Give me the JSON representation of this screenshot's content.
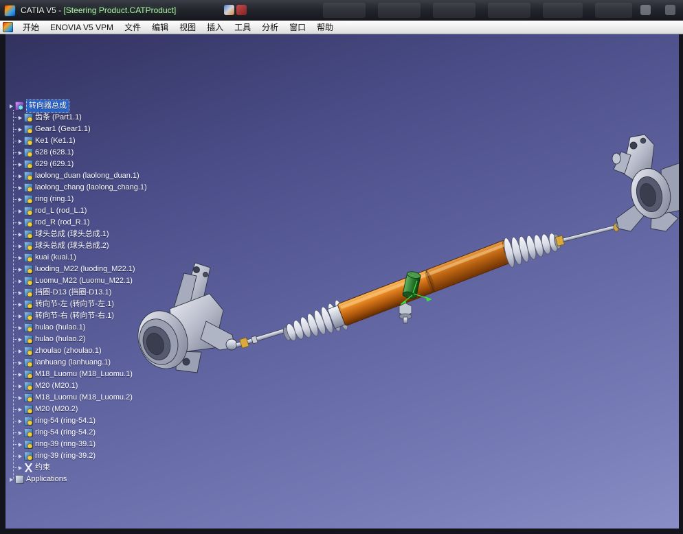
{
  "window": {
    "title_prefix": "CATIA V5 - ",
    "title_document": "[Steering Product.CATProduct]"
  },
  "menubar": {
    "items": [
      {
        "label": "开始"
      },
      {
        "label": "ENOVIA V5 VPM"
      },
      {
        "label": "文件"
      },
      {
        "label": "编辑"
      },
      {
        "label": "视图"
      },
      {
        "label": "插入"
      },
      {
        "label": "工具"
      },
      {
        "label": "分析"
      },
      {
        "label": "窗口"
      },
      {
        "label": "帮助"
      }
    ]
  },
  "tree": {
    "root": {
      "label": "转向器总成",
      "selected": true
    },
    "items": [
      "齿条 (Part1.1)",
      "Gear1 (Gear1.1)",
      "Ke1 (Ke1.1)",
      "628 (628.1)",
      "629 (629.1)",
      "laolong_duan (laolong_duan.1)",
      "laolong_chang (laolong_chang.1)",
      "ring (ring.1)",
      "rod_L (rod_L.1)",
      "rod_R (rod_R.1)",
      "球头总成 (球头总成.1)",
      "球头总成 (球头总成.2)",
      "kuai (kuai.1)",
      "luoding_M22 (luoding_M22.1)",
      "Luomu_M22 (Luomu_M22.1)",
      "挡圈-D13 (挡圈-D13.1)",
      "转向节-左 (转向节-左.1)",
      "转向节-右 (转向节-右.1)",
      "hulao (hulao.1)",
      "hulao (hulao.2)",
      "zhoulao (zhoulao.1)",
      "lanhuang (lanhuang.1)",
      "M18_Luomu (M18_Luomu.1)",
      "M20 (M20.1)",
      "M18_Luomu (M18_Luomu.2)",
      "M20 (M20.2)",
      "ring-54 (ring-54.1)",
      "ring-54 (ring-54.2)",
      "ring-39 (ring-39.1)",
      "ring-39 (ring-39.2)"
    ],
    "special": [
      {
        "label": "约束",
        "type": "constraints"
      },
      {
        "label": "Applications",
        "type": "applications"
      }
    ]
  },
  "colors": {
    "selection_blue": "#2a63c8",
    "housing_orange": "#e07f1e",
    "selected_green": "#2e7d32",
    "knuckle_gray": "#b9bdcb"
  }
}
